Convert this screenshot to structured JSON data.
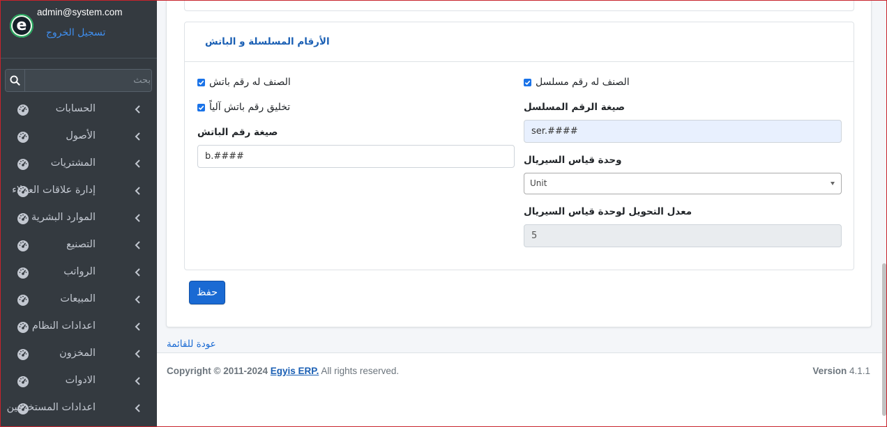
{
  "user": {
    "email": "admin@system.com",
    "logout_label": "تسجيل الخروج",
    "logo_letter": "e"
  },
  "search": {
    "placeholder": "بحث"
  },
  "sidebar": {
    "items": [
      {
        "label": "الحسابات"
      },
      {
        "label": "الأصول"
      },
      {
        "label": "المشتريات"
      },
      {
        "label": "إدارة علاقات العملاء"
      },
      {
        "label": "الموارد البشرية"
      },
      {
        "label": "التصنيع"
      },
      {
        "label": "الرواتب"
      },
      {
        "label": "المبيعات"
      },
      {
        "label": "اعدادات النظام"
      },
      {
        "label": "المخزون"
      },
      {
        "label": "الادوات"
      },
      {
        "label": "اعدادات المستخدمين"
      }
    ]
  },
  "section": {
    "title": "الأرقام المسلسلة و الباتش",
    "has_serial_label": "الصنف له رقم مسلسل",
    "has_serial_checked": true,
    "serial_format_label": "صيغة الرقم المسلسل",
    "serial_format_value": "ser.####",
    "serial_unit_label": "وحدة قياس السيريال",
    "serial_unit_value": "Unit",
    "serial_rate_label": "معدل التحويل لوحدة قياس السيريال",
    "serial_rate_value": "5",
    "has_batch_label": "الصنف له رقم باتش",
    "has_batch_checked": true,
    "auto_batch_label": "تخليق رقم باتش آلياً",
    "auto_batch_checked": true,
    "batch_format_label": "صيغة رقم الباتش",
    "batch_format_value": "b.####"
  },
  "actions": {
    "save_label": "حفظ",
    "back_label": "عودة للقائمة"
  },
  "footer": {
    "copyright_prefix": "Copyright © 2011-2024",
    "brand": "Egyis ERP.",
    "rights": "All rights reserved.",
    "version_label": "Version",
    "version_value": "4.1.1"
  },
  "colors": {
    "sidebar_bg": "#343a40",
    "accent": "#1a6ad3",
    "title": "#1a5fb4"
  }
}
